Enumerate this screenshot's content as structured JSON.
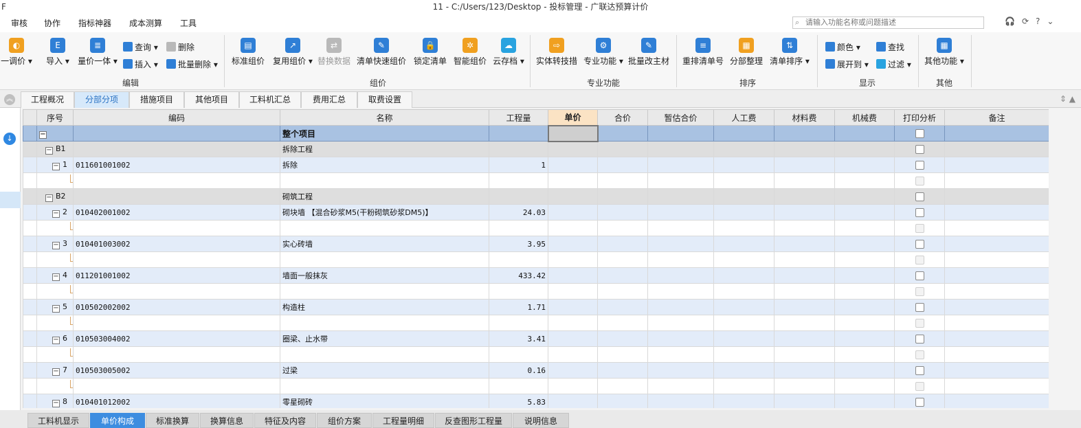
{
  "window": {
    "title": "11 - C:/Users/123/Desktop - 投标管理 - 广联达预算计价",
    "left_mark": "F"
  },
  "menu": [
    "审核",
    "协作",
    "指标神器",
    "成本测算",
    "工具"
  ],
  "search": {
    "placeholder": "请输入功能名称或问题描述"
  },
  "ribbon": {
    "edit": {
      "adjust": "一调价 ▾",
      "import": "导入 ▾",
      "qty_price": "量价一体 ▾",
      "query": "查询 ▾",
      "insert": "插入 ▾",
      "delete": "删除",
      "batch_delete": "批量删除 ▾",
      "label": "编辑"
    },
    "pricing": {
      "std": "标准组价",
      "reuse": "复用组价 ▾",
      "replace": "替换数据",
      "quick": "清单快速组价",
      "lock": "锁定清单",
      "smart": "智能组价",
      "cloud": "云存档 ▾",
      "label": "组价"
    },
    "special": {
      "convert": "实体转技措",
      "func": "专业功能 ▾",
      "batch_mat": "批量改主材",
      "label": "专业功能"
    },
    "sort": {
      "renumber": "重排清单号",
      "organize": "分部整理",
      "order": "清单排序 ▾",
      "label": "排序"
    },
    "display": {
      "color": "颜色 ▾",
      "find": "查找",
      "expand": "展开到 ▾",
      "filter": "过滤 ▾",
      "label": "显示"
    },
    "other": {
      "func": "其他功能 ▾",
      "label": "其他"
    }
  },
  "tabs": [
    "工程概况",
    "分部分项",
    "措施项目",
    "其他项目",
    "工料机汇总",
    "费用汇总",
    "取费设置"
  ],
  "active_tab": "分部分项",
  "table": {
    "headers": [
      "序号",
      "编码",
      "名称",
      "工程量",
      "单价",
      "合价",
      "暂估合价",
      "人工费",
      "材料费",
      "机械费",
      "打印分析",
      "备注"
    ],
    "whole": "整个项目",
    "rows": [
      {
        "kind": "section",
        "seq": "B1",
        "code": "",
        "name": "拆除工程",
        "qty": ""
      },
      {
        "kind": "item",
        "seq": "1",
        "code": "011601001002",
        "name": "拆除",
        "qty": "1"
      },
      {
        "kind": "sub"
      },
      {
        "kind": "section",
        "seq": "B2",
        "code": "",
        "name": "砌筑工程",
        "qty": ""
      },
      {
        "kind": "item",
        "seq": "2",
        "code": "010402001002",
        "name": "砌块墙 【混合砂浆M5(干粉砌筑砂浆DM5)】",
        "qty": "24.03"
      },
      {
        "kind": "sub"
      },
      {
        "kind": "item",
        "seq": "3",
        "code": "010401003002",
        "name": "实心砖墙",
        "qty": "3.95"
      },
      {
        "kind": "sub"
      },
      {
        "kind": "item",
        "seq": "4",
        "code": "011201001002",
        "name": "墙面一般抹灰",
        "qty": "433.42"
      },
      {
        "kind": "sub"
      },
      {
        "kind": "item",
        "seq": "5",
        "code": "010502002002",
        "name": "构造柱",
        "qty": "1.71"
      },
      {
        "kind": "sub"
      },
      {
        "kind": "item",
        "seq": "6",
        "code": "010503004002",
        "name": "圈梁、止水带",
        "qty": "3.41"
      },
      {
        "kind": "sub"
      },
      {
        "kind": "item",
        "seq": "7",
        "code": "010503005002",
        "name": "过梁",
        "qty": "0.16"
      },
      {
        "kind": "sub"
      },
      {
        "kind": "item",
        "seq": "8",
        "code": "010401012002",
        "name": "零星砌砖",
        "qty": "5.83"
      }
    ]
  },
  "bottom_tabs": [
    "工料机显示",
    "单价构成",
    "标准换算",
    "换算信息",
    "特征及内容",
    "组价方案",
    "工程量明细",
    "反查图形工程量",
    "说明信息"
  ],
  "active_bottom_tab": "单价构成",
  "colors": {
    "accent": "#3d8de0",
    "header_price": "#fbe3c4",
    "item_row": "#e3ecf9",
    "section_row": "#dedede",
    "whole_row": "#a9c2e2"
  }
}
